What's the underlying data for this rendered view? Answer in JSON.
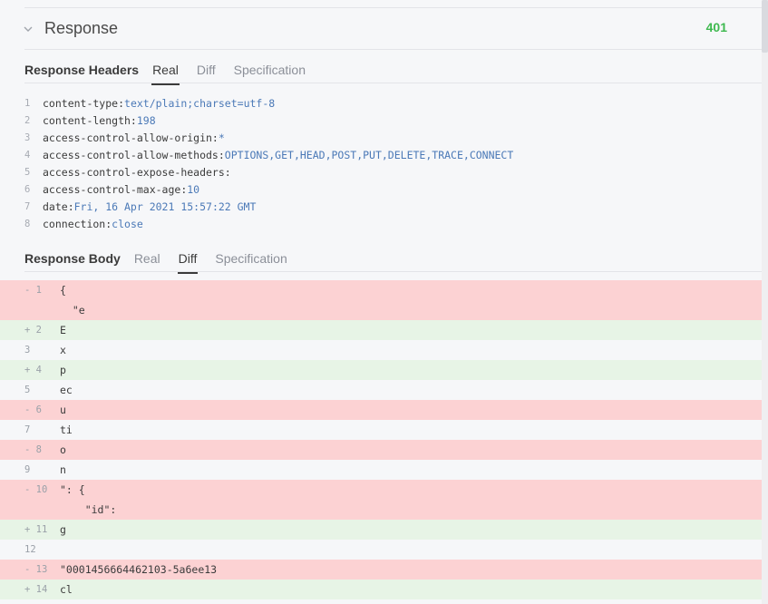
{
  "response": {
    "title": "Response",
    "status": "401"
  },
  "headers_section": {
    "label": "Response Headers",
    "tabs": [
      "Real",
      "Diff",
      "Specification"
    ],
    "active_tab": "Real",
    "lines": [
      {
        "num": "1",
        "key": "content-type:",
        "value": "text/plain;charset=utf-8"
      },
      {
        "num": "2",
        "key": "content-length:",
        "value": "198"
      },
      {
        "num": "3",
        "key": "access-control-allow-origin:",
        "value": "*"
      },
      {
        "num": "4",
        "key": "access-control-allow-methods:",
        "value": "OPTIONS,GET,HEAD,POST,PUT,DELETE,TRACE,CONNECT"
      },
      {
        "num": "5",
        "key": "access-control-expose-headers:",
        "value": ""
      },
      {
        "num": "6",
        "key": "access-control-max-age:",
        "value": "10"
      },
      {
        "num": "7",
        "key": "date:",
        "value": "Fri, 16 Apr 2021 15:57:22 GMT"
      },
      {
        "num": "8",
        "key": "connection:",
        "value": "close"
      }
    ]
  },
  "body_section": {
    "label": "Response Body",
    "tabs": [
      "Real",
      "Diff",
      "Specification"
    ],
    "active_tab": "Diff",
    "diff_lines": [
      {
        "marker": "- 1",
        "type": "del",
        "text": "{\n  \"e"
      },
      {
        "marker": "+ 2",
        "type": "add",
        "text": "E"
      },
      {
        "marker": "3",
        "type": "ctx",
        "text": "x"
      },
      {
        "marker": "+ 4",
        "type": "add",
        "text": "p"
      },
      {
        "marker": "5",
        "type": "ctx",
        "text": "ec"
      },
      {
        "marker": "- 6",
        "type": "del",
        "text": "u"
      },
      {
        "marker": "7",
        "type": "ctx",
        "text": "ti"
      },
      {
        "marker": "- 8",
        "type": "del",
        "text": "o"
      },
      {
        "marker": "9",
        "type": "ctx",
        "text": "n"
      },
      {
        "marker": "- 10",
        "type": "del",
        "text": "\": {\n    \"id\":"
      },
      {
        "marker": "+ 11",
        "type": "add",
        "text": "g"
      },
      {
        "marker": "12",
        "type": "ctx",
        "text": ""
      },
      {
        "marker": "- 13",
        "type": "del",
        "text": "\"0001456664462103-5a6ee13"
      },
      {
        "marker": "+ 14",
        "type": "add",
        "text": "cl"
      }
    ]
  },
  "colors": {
    "status_ok": "#3fb950",
    "value_blue": "#4b79b7",
    "deleted_bg": "#fcd2d3",
    "added_bg": "#e7f4e6"
  },
  "icons": {
    "collapse": "chevron-down-icon"
  }
}
